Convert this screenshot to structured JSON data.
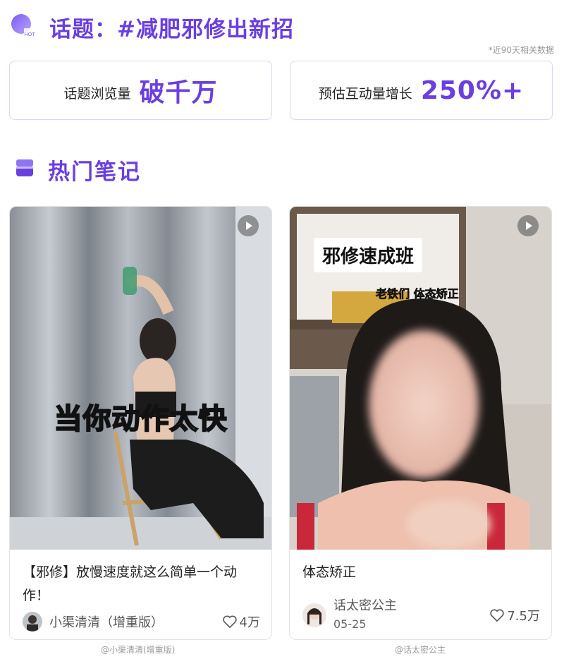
{
  "header": {
    "badge_text": "HOT",
    "title": "话题：#减肥邪修出新招",
    "note": "*近90天相关数据"
  },
  "stats": [
    {
      "label": "话题浏览量",
      "value": "破千万"
    },
    {
      "label": "预估互动量增长",
      "value": "250%+"
    }
  ],
  "section": {
    "title": "热门笔记",
    "icon": "book-stack-icon"
  },
  "notes": [
    {
      "overlay_text": "当你动作太快",
      "title": "【邪修】放慢速度就这么简单一个动作！",
      "author": "小渠清清（增重版）",
      "likes": "4万",
      "caption": "@小渠清清(增重版)"
    },
    {
      "overlay_box": "邪修速成班",
      "overlay_sub": "老铁们 体态矫正",
      "title": "体态矫正",
      "author": "话太密公主",
      "date": "05-25",
      "likes": "7.5万",
      "caption": "@话太密公主"
    }
  ],
  "colors": {
    "accent": "#6a3fe0",
    "border": "#ddd6f3"
  }
}
